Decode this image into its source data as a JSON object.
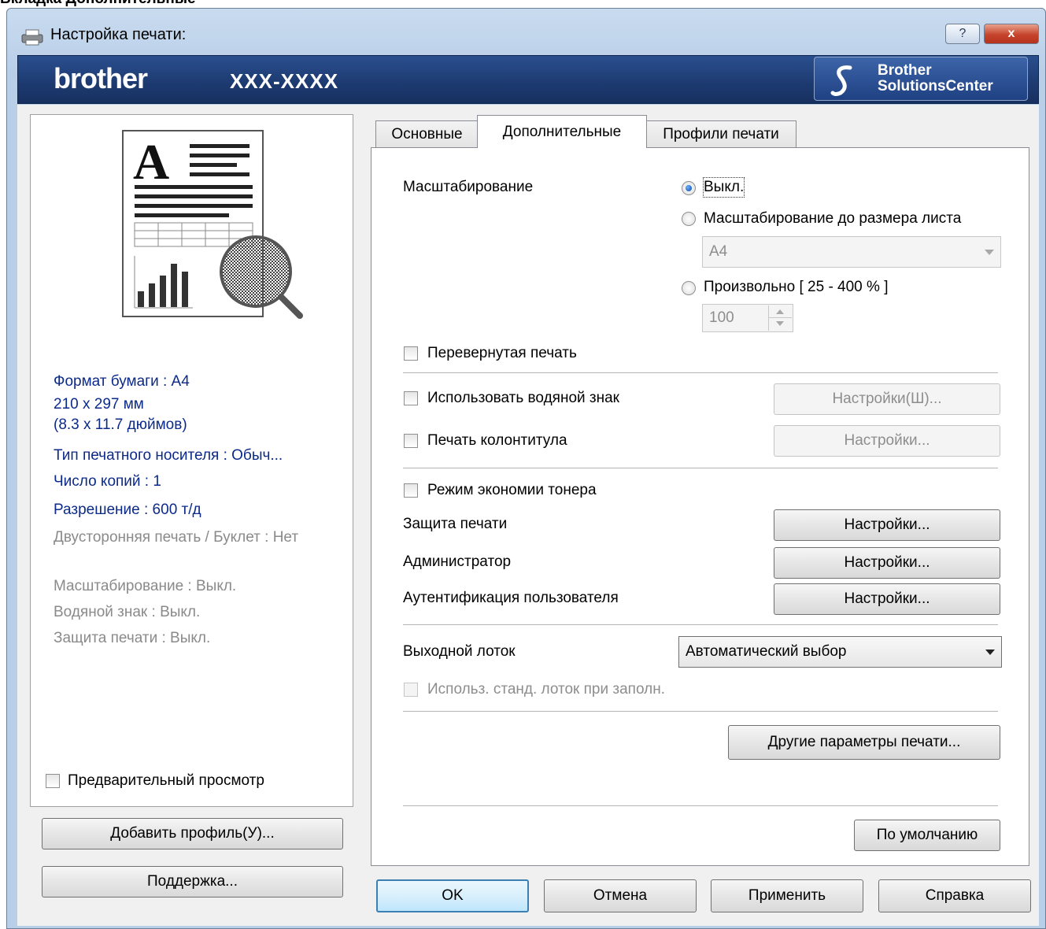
{
  "caption": "Вкладка Дополнительные",
  "window": {
    "title": "Настройка печати:",
    "help_glyph": "?",
    "close_glyph": "x"
  },
  "banner": {
    "logo": "brother",
    "model": "XXX-XXXX",
    "solutions_line1": "Brother",
    "solutions_line2": "SolutionsCenter"
  },
  "summary": {
    "paper_format": "Формат бумаги : A4",
    "paper_size_mm": "210 x 297 мм",
    "paper_size_in": "(8.3 x 11.7 дюймов)",
    "media_type": "Тип печатного носителя : Обыч...",
    "copies": "Число копий : 1",
    "resolution": "Разрешение : 600 т/д",
    "duplex": "Двусторонняя печать / Буклет : Нет",
    "scaling": "Масштабирование : Выкл.",
    "watermark": "Водяной знак : Выкл.",
    "secure_print": "Защита печати : Выкл."
  },
  "left_controls": {
    "preview_label": "Предварительный просмотр",
    "add_profile": "Добавить профиль(У)...",
    "support": "Поддержка..."
  },
  "tabs": [
    "Основные",
    "Дополнительные",
    "Профили печати"
  ],
  "advanced": {
    "scaling_label": "Масштабирование",
    "scaling_off": "Выкл.",
    "fit_to_paper": "Масштабирование до размера листа",
    "fit_paper_value": "A4",
    "free": "Произвольно [ 25 - 400 % ]",
    "free_value": "100",
    "reverse_print": "Перевернутая печать",
    "use_watermark": "Использовать водяной знак",
    "watermark_settings": "Настройки(Ш)...",
    "header_footer": "Печать колонтитула",
    "header_footer_settings": "Настройки...",
    "toner_save": "Режим экономии тонера",
    "secure_print": "Защита печати",
    "secure_print_settings": "Настройки...",
    "administrator": "Администратор",
    "administrator_settings": "Настройки...",
    "user_auth": "Аутентификация пользователя",
    "user_auth_settings": "Настройки...",
    "output_tray": "Выходной лоток",
    "output_tray_value": "Автоматический выбор",
    "use_std_tray": "Использ. станд. лоток при заполн.",
    "other_options": "Другие параметры печати...",
    "default": "По умолчанию"
  },
  "footer": {
    "ok": "OK",
    "cancel": "Отмена",
    "apply": "Применить",
    "help": "Справка"
  },
  "colors": {
    "banner": "#1d3a70",
    "summary_active": "#0b2a8a",
    "summary_dim": "#8a8a8a"
  }
}
